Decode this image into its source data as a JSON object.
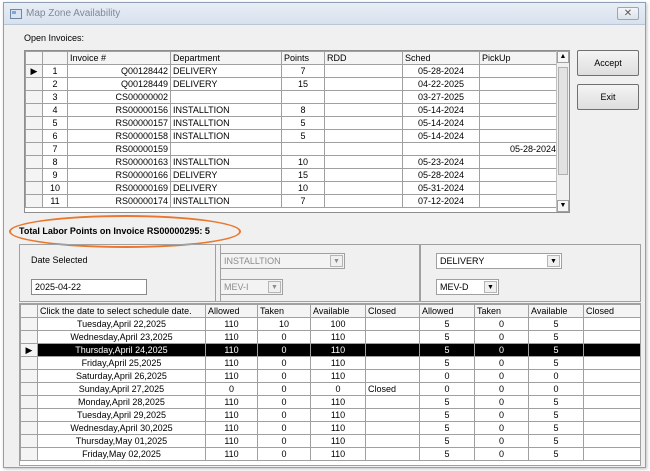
{
  "window": {
    "title": "Map Zone Availability",
    "close_glyph": "✕"
  },
  "open_invoices_label": "Open Invoices:",
  "invoices": {
    "columns": [
      "Invoice #",
      "Department",
      "Points",
      "RDD",
      "Sched",
      "PickUp"
    ],
    "rows": [
      {
        "n": "1",
        "invoice": "Q00128442",
        "dept": "DELIVERY",
        "points": "7",
        "rdd": "",
        "sched": "05-28-2024",
        "pickup": ""
      },
      {
        "n": "2",
        "invoice": "Q00128449",
        "dept": "DELIVERY",
        "points": "15",
        "rdd": "",
        "sched": "04-22-2025",
        "pickup": ""
      },
      {
        "n": "3",
        "invoice": "CS00000002",
        "dept": "",
        "points": "",
        "rdd": "",
        "sched": "03-27-2025",
        "pickup": ""
      },
      {
        "n": "4",
        "invoice": "RS00000156",
        "dept": "INSTALLTION",
        "points": "8",
        "rdd": "",
        "sched": "05-14-2024",
        "pickup": ""
      },
      {
        "n": "5",
        "invoice": "RS00000157",
        "dept": "INSTALLTION",
        "points": "5",
        "rdd": "",
        "sched": "05-14-2024",
        "pickup": ""
      },
      {
        "n": "6",
        "invoice": "RS00000158",
        "dept": "INSTALLTION",
        "points": "5",
        "rdd": "",
        "sched": "05-14-2024",
        "pickup": ""
      },
      {
        "n": "7",
        "invoice": "RS00000159",
        "dept": "",
        "points": "",
        "rdd": "",
        "sched": "",
        "pickup": "05-28-2024"
      },
      {
        "n": "8",
        "invoice": "RS00000163",
        "dept": "INSTALLTION",
        "points": "10",
        "rdd": "",
        "sched": "05-23-2024",
        "pickup": ""
      },
      {
        "n": "9",
        "invoice": "RS00000166",
        "dept": "DELIVERY",
        "points": "15",
        "rdd": "",
        "sched": "05-28-2024",
        "pickup": ""
      },
      {
        "n": "10",
        "invoice": "RS00000169",
        "dept": "DELIVERY",
        "points": "10",
        "rdd": "",
        "sched": "05-31-2024",
        "pickup": ""
      },
      {
        "n": "11",
        "invoice": "RS00000174",
        "dept": "INSTALLTION",
        "points": "7",
        "rdd": "",
        "sched": "07-12-2024",
        "pickup": ""
      }
    ]
  },
  "buttons": {
    "accept": "Accept",
    "exit": "Exit"
  },
  "total_label": "Total Labor Points on Invoice RS00000295: 5",
  "date_selected": {
    "label": "Date Selected",
    "value": "2025-04-22"
  },
  "left_dept": {
    "dept": "INSTALLTION",
    "zone": "MEV-I"
  },
  "right_dept": {
    "dept": "DELIVERY",
    "zone": "MEV-D"
  },
  "schedule": {
    "columns": [
      "Click the date to select schedule date.",
      "Allowed",
      "Taken",
      "Available",
      "Closed",
      "Allowed",
      "Taken",
      "Available",
      "Closed"
    ],
    "rows": [
      {
        "date": "Tuesday,April 22,2025",
        "a1": "110",
        "t1": "10",
        "v1": "100",
        "c1": "",
        "a2": "5",
        "t2": "0",
        "v2": "5",
        "c2": ""
      },
      {
        "date": "Wednesday,April 23,2025",
        "a1": "110",
        "t1": "0",
        "v1": "110",
        "c1": "",
        "a2": "5",
        "t2": "0",
        "v2": "5",
        "c2": ""
      },
      {
        "date": "Thursday,April 24,2025",
        "a1": "110",
        "t1": "0",
        "v1": "110",
        "c1": "",
        "a2": "5",
        "t2": "0",
        "v2": "5",
        "c2": ""
      },
      {
        "date": "Friday,April 25,2025",
        "a1": "110",
        "t1": "0",
        "v1": "110",
        "c1": "",
        "a2": "5",
        "t2": "0",
        "v2": "5",
        "c2": ""
      },
      {
        "date": "Saturday,April 26,2025",
        "a1": "110",
        "t1": "0",
        "v1": "110",
        "c1": "",
        "a2": "0",
        "t2": "0",
        "v2": "0",
        "c2": ""
      },
      {
        "date": "Sunday,April 27,2025",
        "a1": "0",
        "t1": "0",
        "v1": "0",
        "c1": "Closed",
        "a2": "0",
        "t2": "0",
        "v2": "0",
        "c2": ""
      },
      {
        "date": "Monday,April 28,2025",
        "a1": "110",
        "t1": "0",
        "v1": "110",
        "c1": "",
        "a2": "5",
        "t2": "0",
        "v2": "5",
        "c2": ""
      },
      {
        "date": "Tuesday,April 29,2025",
        "a1": "110",
        "t1": "0",
        "v1": "110",
        "c1": "",
        "a2": "5",
        "t2": "0",
        "v2": "5",
        "c2": ""
      },
      {
        "date": "Wednesday,April 30,2025",
        "a1": "110",
        "t1": "0",
        "v1": "110",
        "c1": "",
        "a2": "5",
        "t2": "0",
        "v2": "5",
        "c2": ""
      },
      {
        "date": "Thursday,May 01,2025",
        "a1": "110",
        "t1": "0",
        "v1": "110",
        "c1": "",
        "a2": "5",
        "t2": "0",
        "v2": "5",
        "c2": ""
      },
      {
        "date": "Friday,May 02,2025",
        "a1": "110",
        "t1": "0",
        "v1": "110",
        "c1": "",
        "a2": "5",
        "t2": "0",
        "v2": "5",
        "c2": ""
      }
    ]
  },
  "colors": {
    "highlight_oval": "#e9782d",
    "selected_row": "#000000"
  }
}
